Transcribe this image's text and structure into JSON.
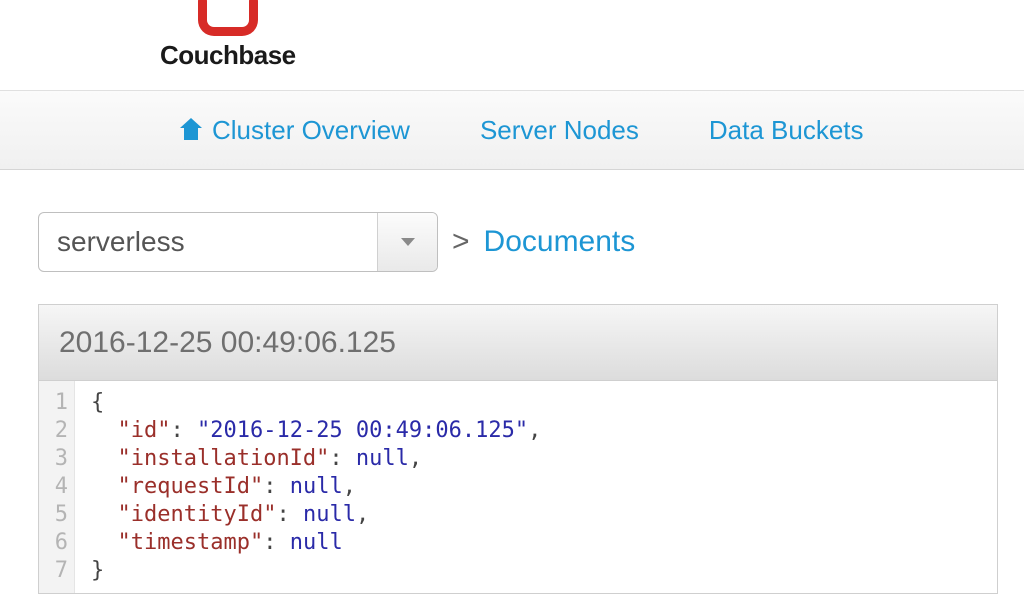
{
  "brand": {
    "name": "Couchbase"
  },
  "nav": {
    "items": [
      {
        "label": "Cluster Overview"
      },
      {
        "label": "Server Nodes"
      },
      {
        "label": "Data Buckets"
      }
    ]
  },
  "breadcrumb": {
    "bucket_selected": "serverless",
    "separator": ">",
    "documents_label": "Documents"
  },
  "document": {
    "id_header": "2016-12-25 00:49:06.125",
    "json_lines": [
      {
        "n": "1",
        "text": "{",
        "kind": "brace"
      },
      {
        "n": "2",
        "key": "id",
        "value": "2016-12-25 00:49:06.125",
        "valueType": "string",
        "comma": true
      },
      {
        "n": "3",
        "key": "installationId",
        "value": "null",
        "valueType": "null",
        "comma": true
      },
      {
        "n": "4",
        "key": "requestId",
        "value": "null",
        "valueType": "null",
        "comma": true
      },
      {
        "n": "5",
        "key": "identityId",
        "value": "null",
        "valueType": "null",
        "comma": true
      },
      {
        "n": "6",
        "key": "timestamp",
        "value": "null",
        "valueType": "null",
        "comma": false
      },
      {
        "n": "7",
        "text": "}",
        "kind": "brace"
      }
    ]
  }
}
